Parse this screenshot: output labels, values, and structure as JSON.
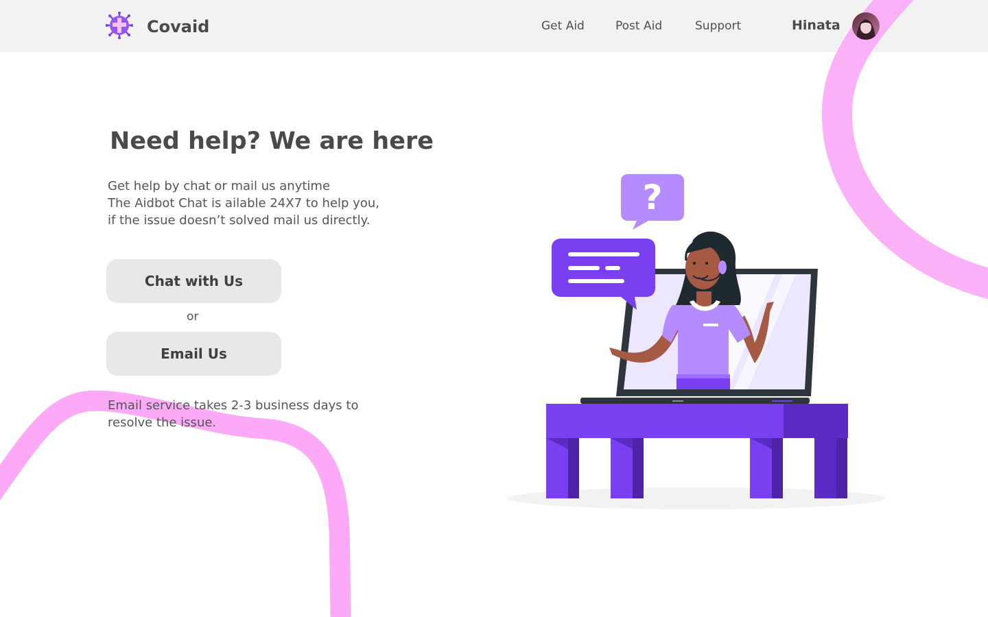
{
  "brand": {
    "name": "Covaid",
    "logo_icon": "virus-cross-icon"
  },
  "nav": {
    "links": [
      {
        "label": "Get Aid"
      },
      {
        "label": "Post Aid"
      },
      {
        "label": "Support"
      }
    ],
    "user": {
      "name": "Hinata",
      "avatar_icon": "user-avatar"
    }
  },
  "main": {
    "heading": "Need help? We are here",
    "intro_lines": [
      "Get help by chat or mail us anytime",
      "The Aidbot Chat is ailable 24X7 to help you,",
      "if the issue doesn’t solved mail us directly."
    ],
    "chat_button": "Chat with Us",
    "or_text": "or",
    "email_button": "Email Us",
    "note_lines": [
      "Email service takes 2-3 business days to",
      "resolve the issue."
    ]
  },
  "illustration": {
    "name": "support-agent-illustration",
    "question_mark": "?"
  },
  "colors": {
    "accent_purple": "#7b3ff2",
    "light_purple": "#b48cff",
    "decor_pink": "#fcaaf7",
    "navbar_bg": "#f2f2f2",
    "button_bg": "#e8e8e8"
  }
}
